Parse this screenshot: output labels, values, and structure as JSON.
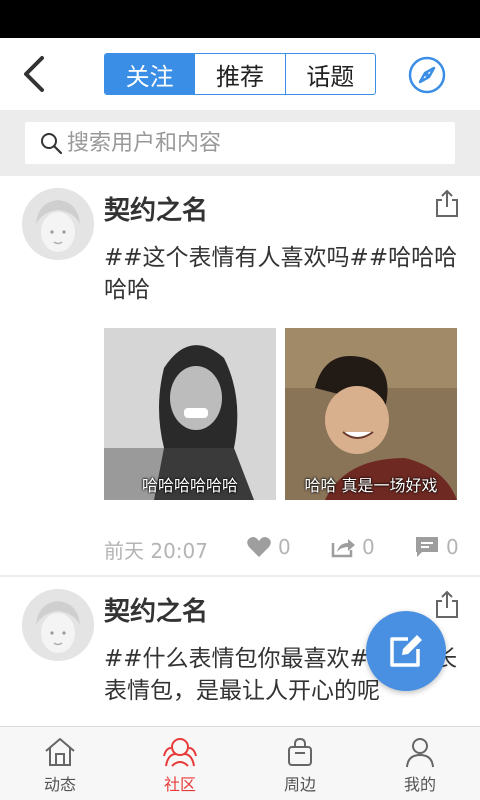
{
  "header": {
    "tabs": [
      {
        "label": "关注",
        "active": true
      },
      {
        "label": "推荐",
        "active": false
      },
      {
        "label": "话题",
        "active": false
      }
    ]
  },
  "search": {
    "placeholder": "搜索用户和内容"
  },
  "posts": [
    {
      "username": "契约之名",
      "text": "##这个表情有人喜欢吗##哈哈哈哈哈",
      "images": [
        {
          "caption": "哈哈哈哈哈哈"
        },
        {
          "caption": "哈哈  真是一场好戏"
        }
      ],
      "time": "前天 20:07",
      "likes": "0",
      "reposts": "0",
      "comments": "0"
    },
    {
      "username": "契约之名",
      "text": "##什么表情包你最喜欢##金馆长表情包，是最让人开心的呢"
    }
  ],
  "tabbar": {
    "items": [
      {
        "label": "动态",
        "icon": "home-icon"
      },
      {
        "label": "社区",
        "icon": "community-icon",
        "active": true
      },
      {
        "label": "周边",
        "icon": "shopping-bag-icon"
      },
      {
        "label": "我的",
        "icon": "person-icon"
      }
    ]
  },
  "colors": {
    "accent": "#3a8ee6",
    "fab": "#4a90e2",
    "active_tab": "#e83a3a",
    "meta": "#b4b4b4"
  }
}
